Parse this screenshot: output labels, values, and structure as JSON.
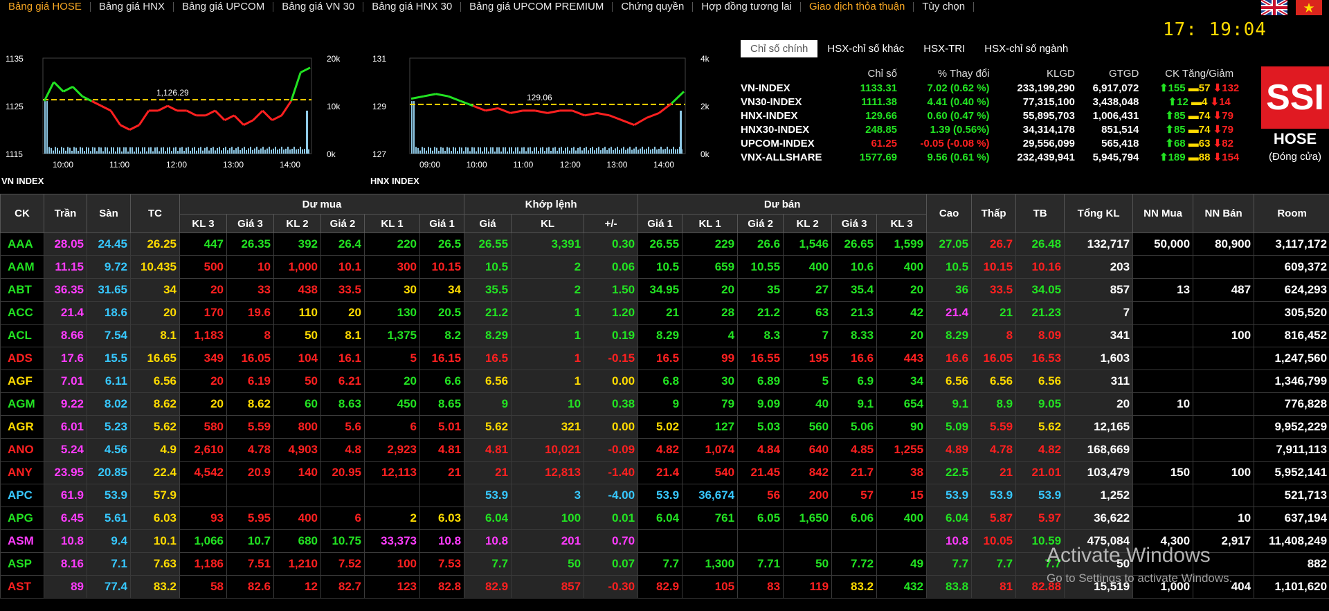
{
  "nav": {
    "items": [
      "Bảng giá HOSE",
      "Bảng giá HNX",
      "Bảng giá UPCOM",
      "Bảng giá VN 30",
      "Bảng giá HNX 30",
      "Bảng giá UPCOM PREMIUM",
      "Chứng quyền",
      "Hợp đồng tương lai",
      "Giao dịch thỏa thuận",
      "Tùy chọn"
    ],
    "active_index": 0,
    "highlight_index": 8
  },
  "clock": "17: 19:04",
  "charts": [
    {
      "title": "VN INDEX",
      "ref_value": "1,126.29",
      "y_left": [
        "1135",
        "1125",
        "1115"
      ],
      "y_right": [
        "20k",
        "10k",
        "0k"
      ],
      "x_labels": [
        "10:00",
        "11:00",
        "12:00",
        "13:00",
        "14:00"
      ],
      "y_range": [
        1115,
        1135
      ],
      "ref": 1126.29,
      "series": [
        1126,
        1130,
        1128,
        1129,
        1127,
        1126,
        1125,
        1124,
        1121,
        1120,
        1121,
        1124,
        1124,
        1125,
        1124,
        1124,
        1123,
        1123,
        1124,
        1122,
        1123,
        1121,
        1122,
        1124,
        1122,
        1123,
        1126,
        1132,
        1133
      ]
    },
    {
      "title": "HNX INDEX",
      "ref_value": "129.06",
      "y_left": [
        "131",
        "129",
        "127"
      ],
      "y_right": [
        "4k",
        "2k",
        "0k"
      ],
      "x_labels": [
        "09:00",
        "10:00",
        "11:00",
        "12:00",
        "13:00",
        "14:00"
      ],
      "y_range": [
        127,
        131
      ],
      "ref": 129.06,
      "series": [
        129.3,
        129.4,
        129.5,
        129.4,
        129.2,
        129.0,
        128.8,
        128.9,
        128.7,
        128.8,
        128.8,
        128.7,
        128.8,
        128.8,
        128.6,
        128.7,
        128.6,
        128.4,
        128.2,
        128.5,
        128.7,
        129.1,
        129.6
      ]
    }
  ],
  "index_tabs": [
    "Chỉ số chính",
    "HSX-chỉ số khác",
    "HSX-TRI",
    "HSX-chỉ số ngành"
  ],
  "index_headers": [
    "Chỉ số",
    "% Thay đổi",
    "KLGD",
    "GTGD",
    "CK Tăng/Giảm"
  ],
  "indices": [
    {
      "name": "VN-INDEX",
      "value": "1133.31",
      "chg": "7.02 (0.62 %)",
      "vol": "233,199,290",
      "val": "6,917,072",
      "up": "155",
      "ref": "57",
      "down": "132",
      "c": "up"
    },
    {
      "name": "VN30-INDEX",
      "value": "1111.38",
      "chg": "4.41 (0.40 %)",
      "vol": "77,315,100",
      "val": "3,438,048",
      "up": "12",
      "ref": "4",
      "down": "14",
      "c": "up"
    },
    {
      "name": "HNX-INDEX",
      "value": "129.66",
      "chg": "0.60 (0.47 %)",
      "vol": "55,895,703",
      "val": "1,006,431",
      "up": "85",
      "ref": "74",
      "down": "79",
      "c": "up"
    },
    {
      "name": "HNX30-INDEX",
      "value": "248.85",
      "chg": "1.39 (0.56%)",
      "vol": "34,314,178",
      "val": "851,514",
      "up": "85",
      "ref": "74",
      "down": "79",
      "c": "up"
    },
    {
      "name": "UPCOM-INDEX",
      "value": "61.25",
      "chg": "-0.05 (-0.08 %)",
      "vol": "29,556,099",
      "val": "565,418",
      "up": "68",
      "ref": "63",
      "down": "82",
      "c": "dn"
    },
    {
      "name": "VNX-ALLSHARE",
      "value": "1577.69",
      "chg": "9.56 (0.61 %)",
      "vol": "232,439,941",
      "val": "5,945,794",
      "up": "189",
      "ref": "88",
      "down": "154",
      "c": "up"
    }
  ],
  "ssi": {
    "logo": "SSI",
    "exchange": "HOSE",
    "status": "(Đóng cửa)"
  },
  "board": {
    "groups": [
      "Dư mua",
      "Khớp lệnh",
      "Dư bán"
    ],
    "cols": [
      "CK",
      "Trần",
      "Sàn",
      "TC",
      "KL 3",
      "Giá 3",
      "KL 2",
      "Giá 2",
      "KL 1",
      "Giá 1",
      "Giá",
      "KL",
      "+/-",
      "Giá 1",
      "KL 1",
      "Giá 2",
      "KL 2",
      "Giá 3",
      "KL 3",
      "Cao",
      "Thấp",
      "TB",
      "Tổng KL",
      "NN Mua",
      "NN Bán",
      "Room"
    ],
    "rows": [
      {
        "c": "up",
        "v": [
          "AAA",
          "28.05",
          "24.45",
          "26.25",
          "447",
          "26.35",
          "392",
          "26.4",
          "220",
          "26.5",
          "26.55",
          "3,391",
          "0.30",
          "26.55",
          "229",
          "26.6",
          "1,546",
          "26.65",
          "1,599",
          "27.05",
          "26.7",
          "26.48",
          "132,717",
          "50,000",
          "80,900",
          "3,117,172"
        ],
        "cc": [
          "up",
          "ce",
          "fl",
          "ref",
          "up",
          "up",
          "up",
          "up",
          "up",
          "up",
          "up",
          "up",
          "up",
          "up",
          "up",
          "up",
          "up",
          "up",
          "up",
          "up",
          "dn",
          "up",
          "wh",
          "wh",
          "wh",
          "wh"
        ]
      },
      {
        "c": "dn",
        "v": [
          "AAM",
          "11.15",
          "9.72",
          "10.435",
          "500",
          "10",
          "1,000",
          "10.1",
          "300",
          "10.15",
          "10.5",
          "2",
          "0.06",
          "10.5",
          "659",
          "10.55",
          "400",
          "10.6",
          "400",
          "10.5",
          "10.15",
          "10.16",
          "203",
          "",
          "",
          "609,372"
        ],
        "cc": [
          "up",
          "ce",
          "fl",
          "ref",
          "dn",
          "dn",
          "dn",
          "dn",
          "dn",
          "dn",
          "up",
          "up",
          "up",
          "up",
          "up",
          "up",
          "up",
          "up",
          "up",
          "up",
          "dn",
          "dn",
          "wh",
          "wh",
          "wh",
          "wh"
        ]
      },
      {
        "c": "up",
        "v": [
          "ABT",
          "36.35",
          "31.65",
          "34",
          "20",
          "33",
          "438",
          "33.5",
          "30",
          "34",
          "35.5",
          "2",
          "1.50",
          "34.95",
          "20",
          "35",
          "27",
          "35.4",
          "20",
          "36",
          "33.5",
          "34.05",
          "857",
          "13",
          "487",
          "624,293"
        ],
        "cc": [
          "up",
          "ce",
          "fl",
          "ref",
          "dn",
          "dn",
          "dn",
          "dn",
          "ref",
          "ref",
          "up",
          "up",
          "up",
          "up",
          "up",
          "up",
          "up",
          "up",
          "up",
          "up",
          "dn",
          "up",
          "wh",
          "wh",
          "wh",
          "wh"
        ]
      },
      {
        "c": "up",
        "v": [
          "ACC",
          "21.4",
          "18.6",
          "20",
          "170",
          "19.6",
          "110",
          "20",
          "130",
          "20.5",
          "21.2",
          "1",
          "1.20",
          "21",
          "28",
          "21.2",
          "63",
          "21.3",
          "42",
          "21.4",
          "21",
          "21.23",
          "7",
          "",
          "",
          "305,520"
        ],
        "cc": [
          "up",
          "ce",
          "fl",
          "ref",
          "dn",
          "dn",
          "ref",
          "ref",
          "up",
          "up",
          "up",
          "up",
          "up",
          "up",
          "up",
          "up",
          "up",
          "up",
          "up",
          "ce",
          "up",
          "up",
          "wh",
          "wh",
          "wh",
          "wh"
        ]
      },
      {
        "c": "up",
        "v": [
          "ACL",
          "8.66",
          "7.54",
          "8.1",
          "1,183",
          "8",
          "50",
          "8.1",
          "1,375",
          "8.2",
          "8.29",
          "1",
          "0.19",
          "8.29",
          "4",
          "8.3",
          "7",
          "8.33",
          "20",
          "8.29",
          "8",
          "8.09",
          "341",
          "",
          "100",
          "816,452"
        ],
        "cc": [
          "up",
          "ce",
          "fl",
          "ref",
          "dn",
          "dn",
          "ref",
          "ref",
          "up",
          "up",
          "up",
          "up",
          "up",
          "up",
          "up",
          "up",
          "up",
          "up",
          "up",
          "up",
          "dn",
          "dn",
          "wh",
          "wh",
          "wh",
          "wh"
        ]
      },
      {
        "c": "dn",
        "v": [
          "ADS",
          "17.6",
          "15.5",
          "16.65",
          "349",
          "16.05",
          "104",
          "16.1",
          "5",
          "16.15",
          "16.5",
          "1",
          "-0.15",
          "16.5",
          "99",
          "16.55",
          "195",
          "16.6",
          "443",
          "16.6",
          "16.05",
          "16.53",
          "1,603",
          "",
          "",
          "1,247,560"
        ],
        "cc": [
          "dn",
          "ce",
          "fl",
          "ref",
          "dn",
          "dn",
          "dn",
          "dn",
          "dn",
          "dn",
          "dn",
          "dn",
          "dn",
          "dn",
          "dn",
          "dn",
          "dn",
          "dn",
          "dn",
          "dn",
          "dn",
          "dn",
          "wh",
          "wh",
          "wh",
          "wh"
        ]
      },
      {
        "c": "ref",
        "v": [
          "AGF",
          "7.01",
          "6.11",
          "6.56",
          "20",
          "6.19",
          "50",
          "6.21",
          "20",
          "6.6",
          "6.56",
          "1",
          "0.00",
          "6.8",
          "30",
          "6.89",
          "5",
          "6.9",
          "34",
          "6.56",
          "6.56",
          "6.56",
          "311",
          "",
          "",
          "1,346,799"
        ],
        "cc": [
          "ref",
          "ce",
          "fl",
          "ref",
          "dn",
          "dn",
          "dn",
          "dn",
          "up",
          "up",
          "ref",
          "ref",
          "ref",
          "up",
          "up",
          "up",
          "up",
          "up",
          "up",
          "ref",
          "ref",
          "ref",
          "wh",
          "wh",
          "wh",
          "wh"
        ]
      },
      {
        "c": "up",
        "v": [
          "AGM",
          "9.22",
          "8.02",
          "8.62",
          "20",
          "8.62",
          "60",
          "8.63",
          "450",
          "8.65",
          "9",
          "10",
          "0.38",
          "9",
          "79",
          "9.09",
          "40",
          "9.1",
          "654",
          "9.1",
          "8.9",
          "9.05",
          "20",
          "10",
          "",
          "776,828"
        ],
        "cc": [
          "up",
          "ce",
          "fl",
          "ref",
          "ref",
          "ref",
          "up",
          "up",
          "up",
          "up",
          "up",
          "up",
          "up",
          "up",
          "up",
          "up",
          "up",
          "up",
          "up",
          "up",
          "up",
          "up",
          "wh",
          "wh",
          "wh",
          "wh"
        ]
      },
      {
        "c": "ref",
        "v": [
          "AGR",
          "6.01",
          "5.23",
          "5.62",
          "580",
          "5.59",
          "800",
          "5.6",
          "6",
          "5.01",
          "5.62",
          "321",
          "0.00",
          "5.02",
          "127",
          "5.03",
          "560",
          "5.06",
          "90",
          "5.09",
          "5.59",
          "5.62",
          "12,165",
          "",
          "",
          "9,952,229"
        ],
        "cc": [
          "ref",
          "ce",
          "fl",
          "ref",
          "dn",
          "dn",
          "dn",
          "dn",
          "dn",
          "dn",
          "ref",
          "ref",
          "ref",
          "ref",
          "up",
          "up",
          "up",
          "up",
          "up",
          "up",
          "dn",
          "ref",
          "wh",
          "wh",
          "wh",
          "wh"
        ]
      },
      {
        "c": "dn",
        "v": [
          "ANO",
          "5.24",
          "4.56",
          "4.9",
          "2,610",
          "4.78",
          "4,903",
          "4.8",
          "2,923",
          "4.81",
          "4.81",
          "10,021",
          "-0.09",
          "4.82",
          "1,074",
          "4.84",
          "640",
          "4.85",
          "1,255",
          "4.89",
          "4.78",
          "4.82",
          "168,669",
          "",
          "",
          "7,911,113"
        ],
        "cc": [
          "dn",
          "ce",
          "fl",
          "ref",
          "dn",
          "dn",
          "dn",
          "dn",
          "dn",
          "dn",
          "dn",
          "dn",
          "dn",
          "dn",
          "dn",
          "dn",
          "dn",
          "dn",
          "dn",
          "dn",
          "dn",
          "dn",
          "wh",
          "wh",
          "wh",
          "wh"
        ]
      },
      {
        "c": "dn",
        "v": [
          "ANY",
          "23.95",
          "20.85",
          "22.4",
          "4,542",
          "20.9",
          "140",
          "20.95",
          "12,113",
          "21",
          "21",
          "12,813",
          "-1.40",
          "21.4",
          "540",
          "21.45",
          "842",
          "21.7",
          "38",
          "22.5",
          "21",
          "21.01",
          "103,479",
          "150",
          "100",
          "5,952,141"
        ],
        "cc": [
          "dn",
          "ce",
          "fl",
          "ref",
          "dn",
          "dn",
          "dn",
          "dn",
          "dn",
          "dn",
          "dn",
          "dn",
          "dn",
          "dn",
          "dn",
          "dn",
          "dn",
          "dn",
          "dn",
          "up",
          "dn",
          "dn",
          "wh",
          "wh",
          "wh",
          "wh"
        ]
      },
      {
        "c": "fl",
        "v": [
          "APC",
          "61.9",
          "53.9",
          "57.9",
          "",
          "",
          "",
          "",
          "",
          "",
          "53.9",
          "3",
          "-4.00",
          "53.9",
          "36,674",
          "56",
          "200",
          "57",
          "15",
          "53.9",
          "53.9",
          "53.9",
          "1,252",
          "",
          "",
          "521,713"
        ],
        "cc": [
          "fl",
          "ce",
          "fl",
          "ref",
          "wh",
          "wh",
          "wh",
          "wh",
          "wh",
          "wh",
          "fl",
          "fl",
          "fl",
          "fl",
          "fl",
          "dn",
          "dn",
          "dn",
          "dn",
          "fl",
          "fl",
          "fl",
          "wh",
          "wh",
          "wh",
          "wh"
        ]
      },
      {
        "c": "up",
        "v": [
          "APG",
          "6.45",
          "5.61",
          "6.03",
          "93",
          "5.95",
          "400",
          "6",
          "2",
          "6.03",
          "6.04",
          "100",
          "0.01",
          "6.04",
          "761",
          "6.05",
          "1,650",
          "6.06",
          "400",
          "6.04",
          "5.87",
          "5.97",
          "36,622",
          "",
          "10",
          "637,194"
        ],
        "cc": [
          "up",
          "ce",
          "fl",
          "ref",
          "dn",
          "dn",
          "dn",
          "dn",
          "ref",
          "ref",
          "up",
          "up",
          "up",
          "up",
          "up",
          "up",
          "up",
          "up",
          "up",
          "up",
          "dn",
          "dn",
          "wh",
          "wh",
          "wh",
          "wh"
        ]
      },
      {
        "c": "ce",
        "v": [
          "ASM",
          "10.8",
          "9.4",
          "10.1",
          "1,066",
          "10.7",
          "680",
          "10.75",
          "33,373",
          "10.8",
          "10.8",
          "201",
          "0.70",
          "",
          "",
          "",
          "",
          "",
          "",
          "10.8",
          "10.05",
          "10.59",
          "475,084",
          "4,300",
          "2,917",
          "11,408,249"
        ],
        "cc": [
          "ce",
          "ce",
          "fl",
          "ref",
          "up",
          "up",
          "up",
          "up",
          "ce",
          "ce",
          "ce",
          "ce",
          "ce",
          "wh",
          "wh",
          "wh",
          "wh",
          "wh",
          "wh",
          "ce",
          "dn",
          "up",
          "wh",
          "wh",
          "wh",
          "wh"
        ]
      },
      {
        "c": "up",
        "v": [
          "ASP",
          "8.16",
          "7.1",
          "7.63",
          "1,186",
          "7.51",
          "1,210",
          "7.52",
          "100",
          "7.53",
          "7.7",
          "50",
          "0.07",
          "7.7",
          "1,300",
          "7.71",
          "50",
          "7.72",
          "49",
          "7.7",
          "7.7",
          "7.7",
          "50",
          "",
          "",
          "882"
        ],
        "cc": [
          "up",
          "ce",
          "fl",
          "ref",
          "dn",
          "dn",
          "dn",
          "dn",
          "dn",
          "dn",
          "up",
          "up",
          "up",
          "up",
          "up",
          "up",
          "up",
          "up",
          "up",
          "up",
          "up",
          "up",
          "wh",
          "wh",
          "wh",
          "wh"
        ]
      },
      {
        "c": "dn",
        "v": [
          "AST",
          "89",
          "77.4",
          "83.2",
          "58",
          "82.6",
          "12",
          "82.7",
          "123",
          "82.8",
          "82.9",
          "857",
          "-0.30",
          "82.9",
          "105",
          "83",
          "119",
          "83.2",
          "432",
          "83.8",
          "81",
          "82.88",
          "15,519",
          "1,000",
          "404",
          "1,101,620"
        ],
        "cc": [
          "dn",
          "ce",
          "fl",
          "ref",
          "dn",
          "dn",
          "dn",
          "dn",
          "dn",
          "dn",
          "dn",
          "dn",
          "dn",
          "dn",
          "dn",
          "dn",
          "dn",
          "ref",
          "up",
          "up",
          "dn",
          "dn",
          "wh",
          "wh",
          "wh",
          "wh"
        ]
      }
    ]
  },
  "watermark": {
    "title": "Activate Windows",
    "subtitle": "Go to Settings to activate Windows."
  },
  "colors": {
    "up": "#22e322",
    "down": "#ff2020",
    "ref": "#ffdb00",
    "ceiling": "#ff3cff",
    "floor": "#37c8ff",
    "ssi": "#e01a22"
  }
}
